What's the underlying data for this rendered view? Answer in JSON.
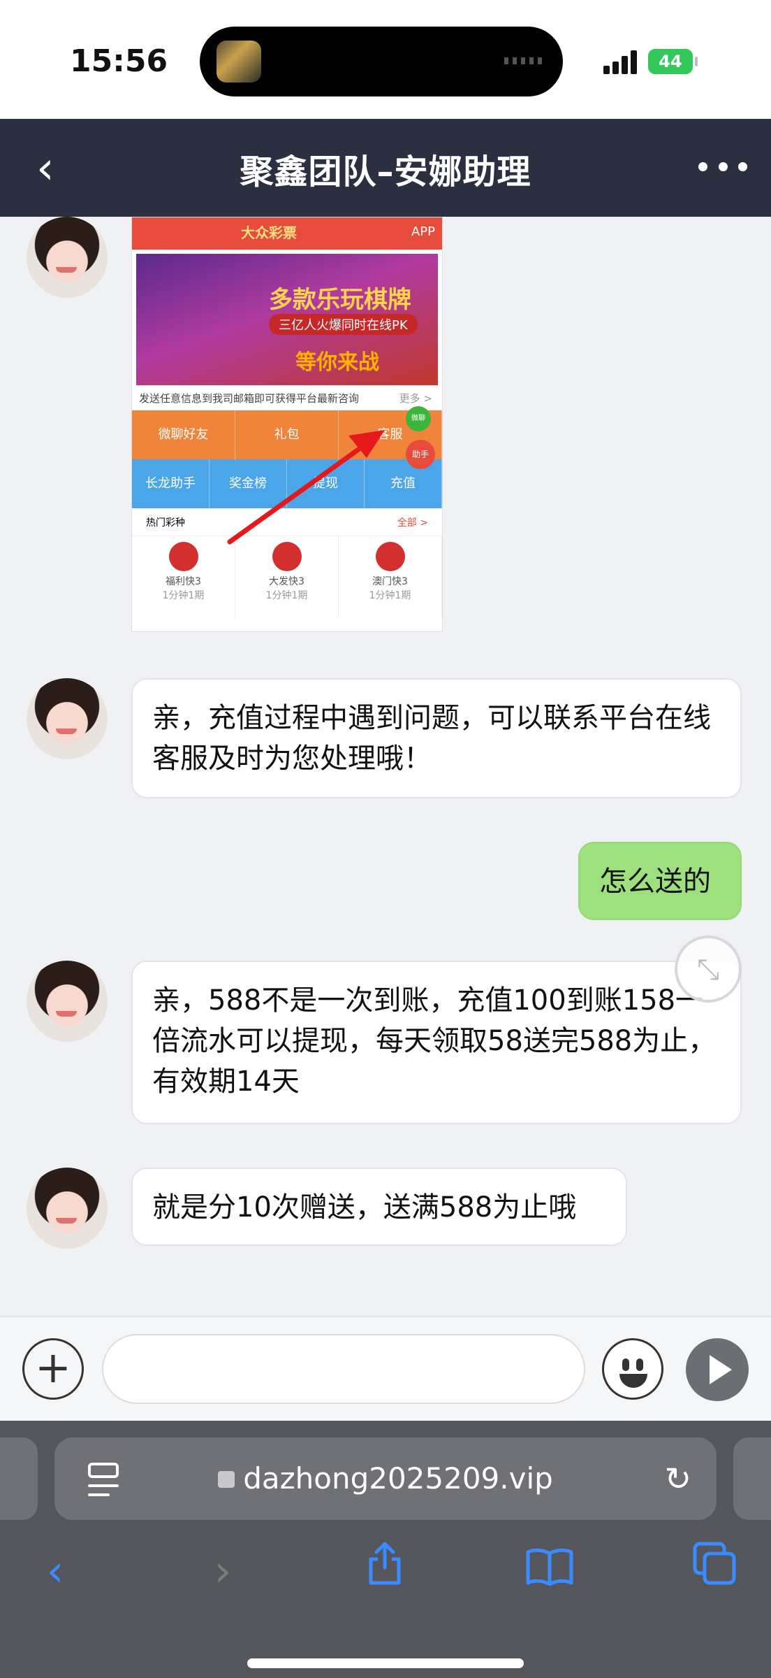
{
  "status_bar": {
    "time": "15:56",
    "battery": "44"
  },
  "header": {
    "title": "聚鑫团队–安娜助理"
  },
  "shared_image": {
    "logo": "大众彩票",
    "app_label": "APP",
    "banner_title": "多款乐玩棋牌",
    "banner_sub": "三亿人火爆同时在线PK",
    "banner_cta": "等你来战",
    "notice": "发送任意信息到我司邮箱即可获得平台最新咨询",
    "notice_more": "更多 >",
    "row1": [
      "微聊好友",
      "礼包",
      "客服"
    ],
    "row2": [
      "长龙助手",
      "奖金榜",
      "提现",
      "充值"
    ],
    "badge_green": "微聊",
    "badge_red": "助手",
    "hot_label": "热门彩种",
    "hot_all": "全部 >",
    "games": [
      {
        "name": "福利快3",
        "period": "1分钟1期"
      },
      {
        "name": "大发快3",
        "period": "1分钟1期"
      },
      {
        "name": "澳门快3",
        "period": "1分钟1期"
      }
    ]
  },
  "messages": [
    {
      "from": "agent",
      "text": "亲，充值过程中遇到问题，可以联系平台在线客服及时为您处理哦！"
    },
    {
      "from": "me",
      "text": "怎么送的"
    },
    {
      "from": "agent",
      "text": "亲，588不是一次到账，充值100到账158一倍流水可以提现，每天领取58送完588为止，有效期14天"
    },
    {
      "from": "agent",
      "text": "就是分10次赠送，送满588为止哦"
    }
  ],
  "input": {
    "value": "",
    "placeholder": ""
  },
  "browser": {
    "url": "dazhong2025209.vip"
  },
  "icons": {
    "back": "chevron-left-icon",
    "more": "ellipsis-icon",
    "plus": "plus-circle-icon",
    "emoji": "smiley-icon",
    "send": "send-icon",
    "reader": "reader-mode-icon",
    "lock": "lock-icon",
    "reload": "reload-icon",
    "share": "share-icon",
    "bookmarks": "book-icon",
    "tabs": "tabs-icon"
  },
  "colors": {
    "header_bg": "#2a3040",
    "my_bubble": "#9ee07d",
    "accent_blue": "#3a8bff"
  }
}
